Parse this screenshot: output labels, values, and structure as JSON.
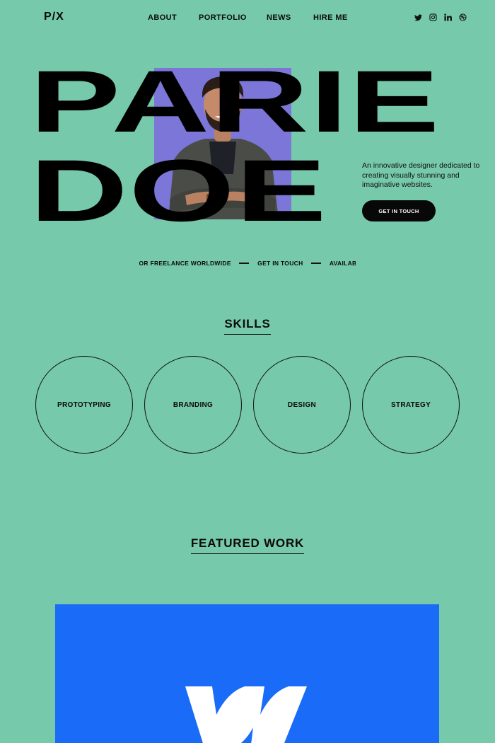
{
  "header": {
    "logo": "P/X",
    "nav": [
      "ABOUT",
      "PORTFOLIO",
      "NEWS",
      "HIRE ME"
    ],
    "socials": [
      "twitter-icon",
      "instagram-icon",
      "linkedin-icon",
      "dribbble-icon"
    ]
  },
  "hero": {
    "line1": "PARIE",
    "line2": "DOE",
    "intro": "An innovative designer dedicated to creating visually stunning and imaginative websites.",
    "cta": "GET IN TOUCH",
    "photo_bg": "#7b76d8"
  },
  "ticker": {
    "items": [
      "FOR FREELANCE WORLDWIDE",
      "GET IN TOUCH",
      "AVAILABLE FOR FREELANCE WORLDWIDE"
    ]
  },
  "skills": {
    "title": "SKILLS",
    "items": [
      "PROTOTYPING",
      "BRANDING",
      "DESIGN",
      "STRATEGY"
    ]
  },
  "featured": {
    "title": "FEATURED WORK",
    "card_color": "#1a6cf8"
  },
  "colors": {
    "background": "#76c9ab",
    "text": "#0b0b0b",
    "accent_blue": "#1a6cf8"
  }
}
